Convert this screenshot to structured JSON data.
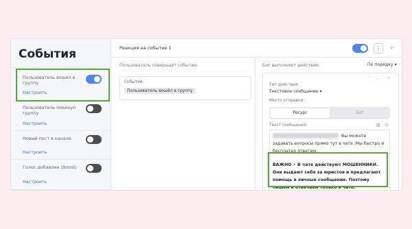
{
  "sidebar": {
    "title": "События",
    "events": [
      {
        "label": "Пользователь вошёл в группу",
        "action": "Настроить",
        "toggle": "on"
      },
      {
        "label": "Пользователь покинул группу",
        "action": "Настроить",
        "toggle": "off"
      },
      {
        "label": "Новый пост в канале",
        "action": "Настроить",
        "toggle": "off"
      },
      {
        "label": "Голос добавлен (Boost)",
        "action": "Настроить",
        "toggle": "off"
      }
    ]
  },
  "header": {
    "title": "Реакция на событие 1",
    "menu_icon": "⋮",
    "chevron_icon": "⌄"
  },
  "left_column": {
    "heading": "Пользователь совершает событие:",
    "event_label": "Событие:",
    "event_value": "Пользователь вошёл в группу"
  },
  "right_column": {
    "heading": "Бот выполняет действие:",
    "sort": "По порядку ▾",
    "action_type_label": "Тип действия:",
    "action_type_value": "Текстовое сообщение ▾",
    "send_place_label": "Место отправки:",
    "send_options": [
      "Ресурс",
      "Бот"
    ],
    "message_label": "Текст сообщения:",
    "message_part1": "Вы можете задавать вопросы прямо тут в чате. Мы быстро и бесплатно ответим.",
    "message_part2": "ВАЖНО ⚡ В чате действуют МОШЕННИКИ. Они выдают себя за юристов и предлагают помощь в личные сообщения. Поэтому пишем и отвечаем только в чате.",
    "card_controls": [
      "⌃",
      "⌄",
      "✕"
    ]
  },
  "colors": {
    "accent": "#4a88f0",
    "highlight": "#5aa832",
    "background": "#fbeef0"
  }
}
